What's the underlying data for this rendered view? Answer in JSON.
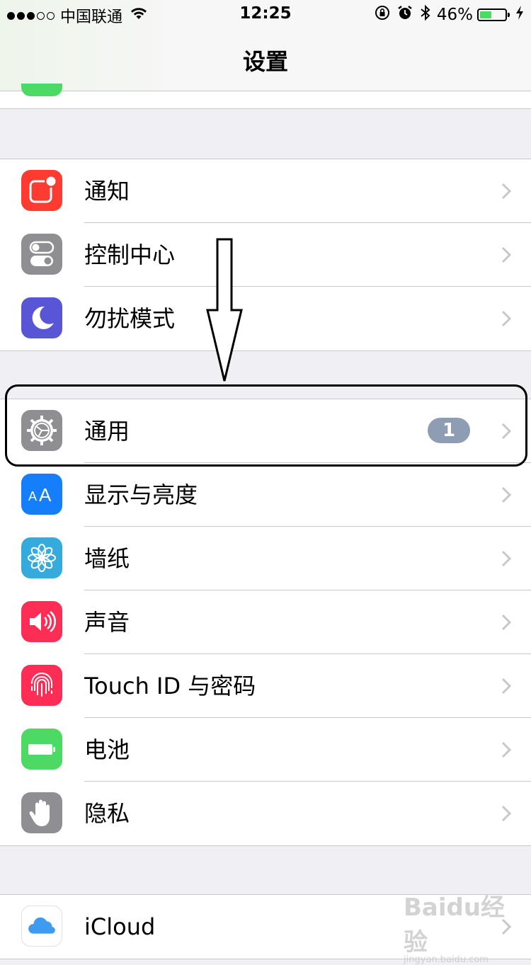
{
  "status_bar": {
    "signal_dots_filled": 3,
    "signal_dots_total": 5,
    "carrier": "中国联通",
    "time": "12:25",
    "battery_percent": "46%",
    "battery_level": 0.46
  },
  "nav": {
    "title": "设置"
  },
  "groups": [
    {
      "rows": [
        {
          "label": "通知",
          "icon": "notifications-icon",
          "color": "#fe3b30"
        },
        {
          "label": "控制中心",
          "icon": "control-center-icon",
          "color": "#8e8e93"
        },
        {
          "label": "勿扰模式",
          "icon": "moon-icon",
          "color": "#5856d6"
        }
      ]
    },
    {
      "rows": [
        {
          "label": "通用",
          "icon": "gear-icon",
          "color": "#8e8e93",
          "badge": "1"
        },
        {
          "label": "显示与亮度",
          "icon": "display-brightness-icon",
          "color": "#157efb"
        },
        {
          "label": "墙纸",
          "icon": "wallpaper-flower-icon",
          "color": "#35aadc"
        },
        {
          "label": "声音",
          "icon": "speaker-icon",
          "color": "#fe2d55"
        },
        {
          "label": "Touch ID 与密码",
          "icon": "fingerprint-icon",
          "color": "#fe2d55"
        },
        {
          "label": "电池",
          "icon": "battery-icon",
          "color": "#4cd964"
        },
        {
          "label": "隐私",
          "icon": "hand-icon",
          "color": "#8e8e93"
        }
      ]
    },
    {
      "rows": [
        {
          "label": "iCloud",
          "icon": "icloud-icon",
          "color": "#ffffff"
        }
      ]
    }
  ],
  "watermark": {
    "text": "Baidu经验",
    "subtext": "jingyan.baidu.com"
  }
}
